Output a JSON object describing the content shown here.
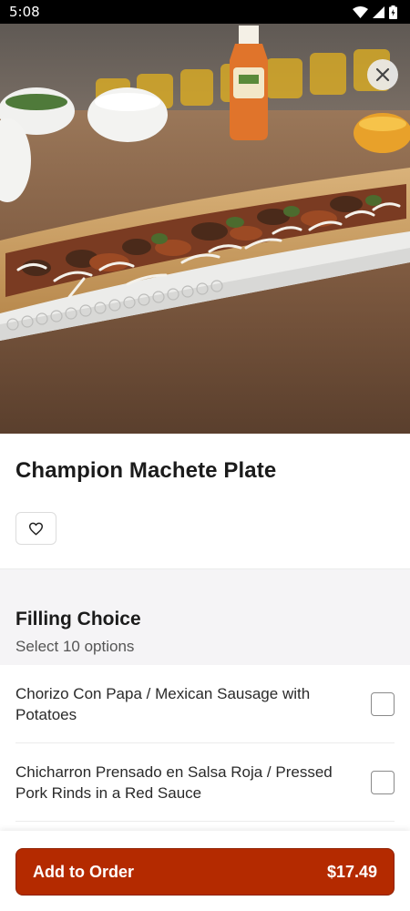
{
  "status_bar": {
    "time": "5:08",
    "icons": [
      "wifi-icon",
      "signal-icon",
      "battery-icon"
    ]
  },
  "hero": {
    "close_icon": "close-icon"
  },
  "item": {
    "title": "Champion Machete Plate",
    "favorite_icon": "heart-icon"
  },
  "section": {
    "title": "Filling Choice",
    "subtitle": "Select 10 options"
  },
  "options": [
    {
      "label": "Chorizo Con Papa / Mexican Sausage with Potatoes",
      "checked": false
    },
    {
      "label": "Chicharron Prensado en Salsa Roja / Pressed Pork Rinds in a Red Sauce",
      "checked": false
    }
  ],
  "order": {
    "button_label": "Add to Order",
    "price": "$17.49"
  },
  "colors": {
    "accent": "#b42a00",
    "section_background": "#f5f4f6"
  }
}
